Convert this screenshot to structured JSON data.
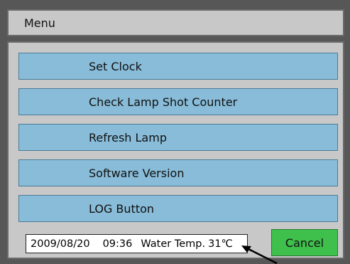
{
  "title": "Menu",
  "menu": {
    "items": [
      {
        "label": "Set Clock"
      },
      {
        "label": "Check Lamp Shot Counter"
      },
      {
        "label": "Refresh Lamp"
      },
      {
        "label": "Software Version"
      },
      {
        "label": "LOG Button"
      }
    ]
  },
  "status": {
    "date": "2009/08/20",
    "time": "09:36",
    "temp_label": "Water Temp.",
    "temp_value": "31℃"
  },
  "cancel_label": "Cancel",
  "colors": {
    "background": "#575757",
    "panel": "#c8c8c8",
    "menu_button": "#88bcd8",
    "cancel_button": "#3fbf4b"
  },
  "icons": {
    "pointer": "arrow-pointer-icon"
  }
}
